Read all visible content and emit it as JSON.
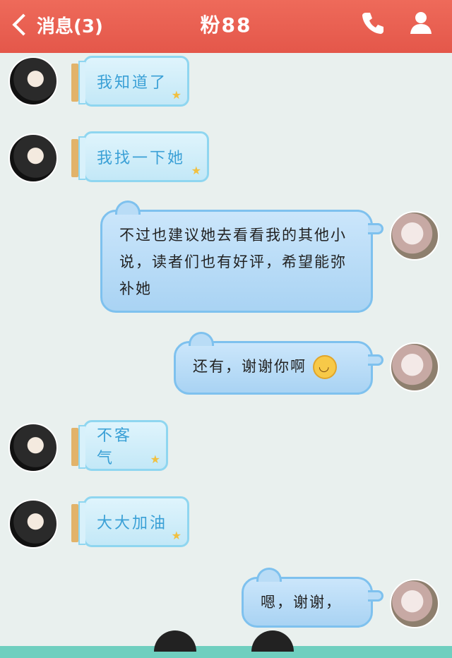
{
  "header": {
    "back_label": "消息(3)",
    "title": "粉88",
    "icons": [
      "back-chevron-icon",
      "phone-icon",
      "user-profile-icon"
    ]
  },
  "messages": [
    {
      "side": "left",
      "text": "我知道了"
    },
    {
      "side": "left",
      "text": "我找一下她"
    },
    {
      "side": "right",
      "text": "不过也建议她去看看我的其他小说，读者们也有好评，希望能弥补她"
    },
    {
      "side": "right",
      "text": "还有，谢谢你啊",
      "emoji": "grinning-face-icon"
    },
    {
      "side": "left",
      "text": "不客气"
    },
    {
      "side": "left",
      "text": "大大加油"
    },
    {
      "side": "right",
      "text": "嗯，谢谢，"
    }
  ],
  "colors": {
    "header": "#e4574a",
    "background": "#e9f0ee",
    "right_bubble": "#a9d3f3",
    "left_bubble": "#c3e8f7"
  }
}
